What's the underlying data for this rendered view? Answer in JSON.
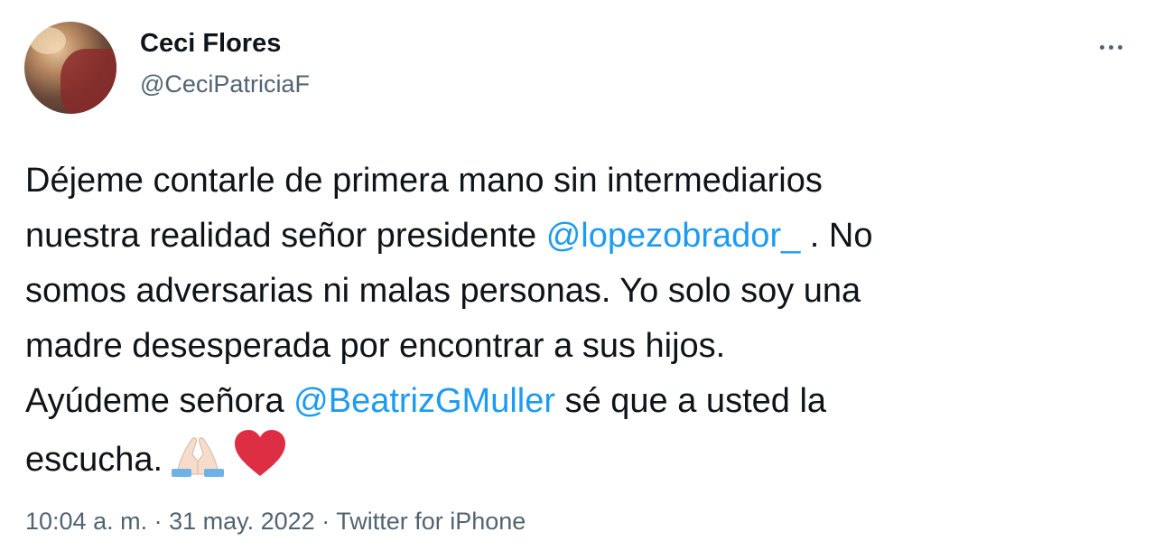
{
  "author": {
    "name": "Ceci Flores",
    "handle": "@CeciPatriciaF"
  },
  "tweet": {
    "line1": "Déjeme contarle de primera mano sin intermediarios",
    "line2_before": "nuestra realidad señor presidente ",
    "mention1": "@lopezobrador_",
    "line2_after": " . No",
    "line3": "somos adversarias ni malas personas. Yo solo soy una",
    "line4": "madre desesperada por encontrar a sus hijos.",
    "line5_before": "Ayúdeme señora ",
    "mention2": "@BeatrizGMuller",
    "line5_after": " sé que a usted la",
    "line6": "escucha.",
    "emojis": [
      "folded-hands-icon",
      "red-heart-icon"
    ]
  },
  "meta": {
    "time": "10:04 a. m.",
    "separator": " · ",
    "date": "31 may. 2022",
    "source": "Twitter for iPhone"
  },
  "colors": {
    "text": "#0f1419",
    "secondary": "#536471",
    "link": "#1d9bf0",
    "heart": "#e0245e"
  }
}
